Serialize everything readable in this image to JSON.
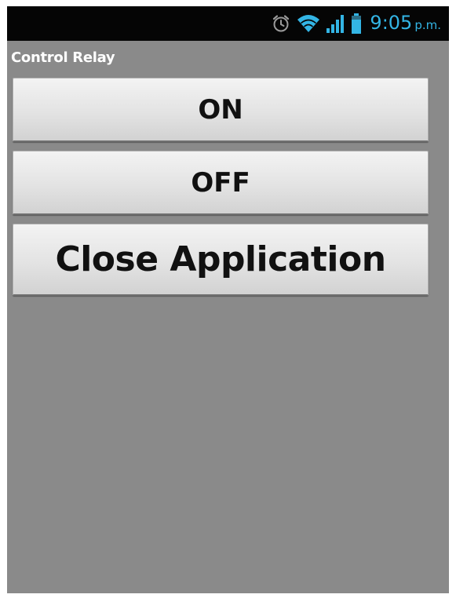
{
  "status_bar": {
    "time": "9:05",
    "ampm": "p.m.",
    "icons": [
      "alarm-icon",
      "wifi-icon",
      "signal-icon",
      "battery-icon"
    ]
  },
  "app": {
    "title": "Control Relay"
  },
  "buttons": {
    "on_label": "ON",
    "off_label": "OFF",
    "close_label": "Close Application"
  },
  "colors": {
    "status_bar_bg": "#050505",
    "status_accent": "#33b5e5",
    "screen_bg": "#8a8a8a",
    "button_text": "#111111"
  }
}
